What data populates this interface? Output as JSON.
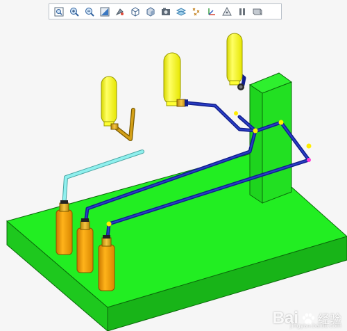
{
  "toolbar": {
    "buttons": [
      {
        "icon": "zoom-fit-icon"
      },
      {
        "icon": "zoom-in-icon"
      },
      {
        "icon": "zoom-out-icon"
      },
      {
        "icon": "repaint-icon"
      },
      {
        "icon": "spin-center-icon"
      },
      {
        "icon": "saved-orientation-icon"
      },
      {
        "icon": "display-style-icon"
      },
      {
        "icon": "view-manager-icon"
      },
      {
        "icon": "datum-display-icon"
      },
      {
        "icon": "point-display-icon"
      },
      {
        "icon": "csys-display-icon"
      },
      {
        "icon": "annotation-display-icon"
      },
      {
        "icon": "pause-icon"
      },
      {
        "icon": "view-tools-icon"
      }
    ]
  },
  "watermark": {
    "logo_text": "Bai",
    "text_cn": "经验",
    "url": "jingyan.baidu.com"
  },
  "colors": {
    "base_plate": "#22ee22",
    "pipe_blue": "#101e8c",
    "pipe_cyan": "#8ff0ee",
    "tank_yellow": "#ffff00",
    "bottle_orange": "#ee9900"
  }
}
